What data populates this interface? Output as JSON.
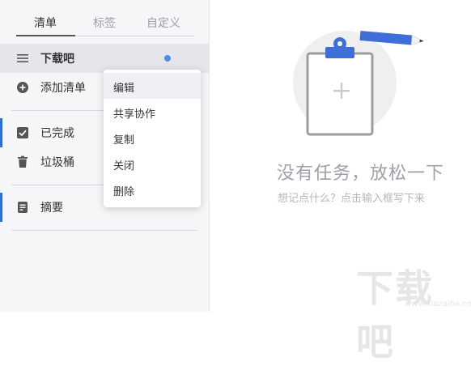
{
  "tabs": [
    {
      "label": "清单",
      "active": true
    },
    {
      "label": "标签",
      "active": false
    },
    {
      "label": "自定义",
      "active": false
    }
  ],
  "sidebar": {
    "list": {
      "label": "下载吧",
      "icon": "menu-lines-icon",
      "has_dot": true
    },
    "add_list": {
      "label": "添加清单",
      "icon": "plus-circle-icon"
    },
    "completed": {
      "label": "已完成",
      "icon": "checkbox-icon"
    },
    "trash": {
      "label": "垃圾桶",
      "icon": "trash-icon"
    },
    "summary": {
      "label": "摘要",
      "icon": "document-icon"
    }
  },
  "context_menu": {
    "items": [
      "编辑",
      "共享协作",
      "复制",
      "关闭",
      "删除"
    ],
    "hovered_index": 0
  },
  "empty_state": {
    "title": "没有任务，放松一下",
    "subtitle": "想记点什么？点击输入框写下来",
    "illustration": "clipboard-with-pencil"
  },
  "watermark": {
    "text": "下载吧",
    "url": "www.xiazaiba.com"
  },
  "colors": {
    "accent": "#4a90e2",
    "illustration_blue": "#3e6fd9",
    "sidebar_bg": "#f5f6f8"
  }
}
